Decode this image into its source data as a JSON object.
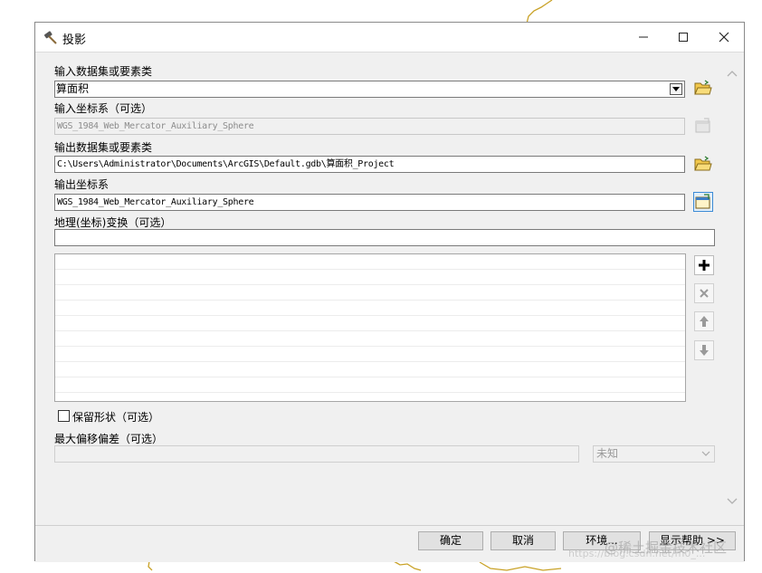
{
  "window": {
    "title": "投影",
    "minimize_icon": "minimize-icon",
    "maximize_icon": "maximize-icon",
    "close_icon": "close-icon"
  },
  "form": {
    "input_dataset_label": "输入数据集或要素类",
    "input_dataset_value": "算面积",
    "input_crs_label": "输入坐标系（可选）",
    "input_crs_value": "WGS_1984_Web_Mercator_Auxiliary_Sphere",
    "output_dataset_label": "输出数据集或要素类",
    "output_dataset_value": "C:\\Users\\Administrator\\Documents\\ArcGIS\\Default.gdb\\算面积_Project",
    "output_crs_label": "输出坐标系",
    "output_crs_value": "WGS_1984_Web_Mercator_Auxiliary_Sphere",
    "geo_transform_label": "地理(坐标)变换（可选）",
    "geo_transform_value": "",
    "preserve_shape_label": "保留形状（可选）",
    "preserve_shape_checked": false,
    "max_offset_label": "最大偏移偏差（可选）",
    "max_offset_value": "",
    "unit_value": "未知"
  },
  "buttons": {
    "ok": "确定",
    "cancel": "取消",
    "environments": "环境...",
    "show_help": "显示帮助 >>"
  },
  "icons": {
    "tool": "hammer-icon",
    "open_folder": "open-folder-icon",
    "crs_properties": "properties-icon",
    "add": "plus-icon",
    "remove": "x-icon",
    "up": "arrow-up-icon",
    "down": "arrow-down-icon"
  },
  "watermark": {
    "text": "@稀土掘金技术社区",
    "url": "https://blog.csdn.net/m0_..."
  },
  "colors": {
    "dialog_bg": "#f0f0f0",
    "folder_yellow": "#f2c84b",
    "active_border": "#3c8bd6",
    "map_line": "#c9a227"
  }
}
